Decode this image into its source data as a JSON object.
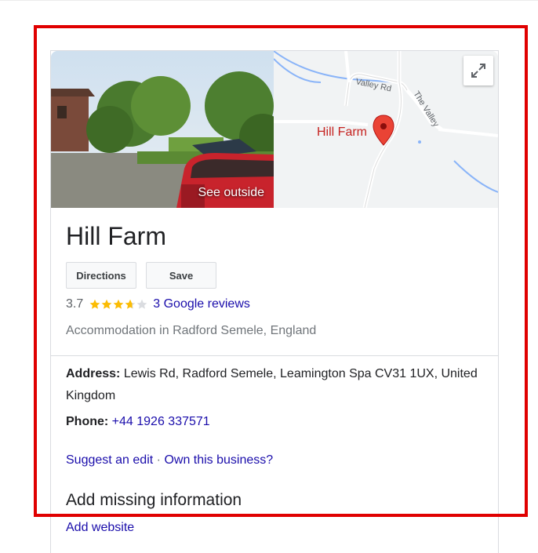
{
  "panel": {
    "photo_label": "See outside",
    "map_place_label": "Hill Farm",
    "map_roads": [
      "Valley Rd",
      "The Valley"
    ],
    "title": "Hill Farm",
    "buttons": {
      "directions": "Directions",
      "save": "Save"
    },
    "rating": {
      "value": "3.7",
      "stars": 3.7,
      "reviews_link": "3 Google reviews"
    },
    "category": "Accommodation in Radford Semele, England",
    "address": {
      "label": "Address:",
      "value": "Lewis Rd, Radford Semele, Leamington Spa CV31 1UX, United Kingdom"
    },
    "phone": {
      "label": "Phone:",
      "value": "+44 1926 337571"
    },
    "suggest_edit": "Suggest an edit",
    "separator": "·",
    "own_business": "Own this business?",
    "add_missing_heading": "Add missing information",
    "add_website": "Add website"
  },
  "colors": {
    "highlight": "#e00000",
    "link": "#1a0dab",
    "star": "#fbbc04",
    "pin": "#ea4335"
  }
}
